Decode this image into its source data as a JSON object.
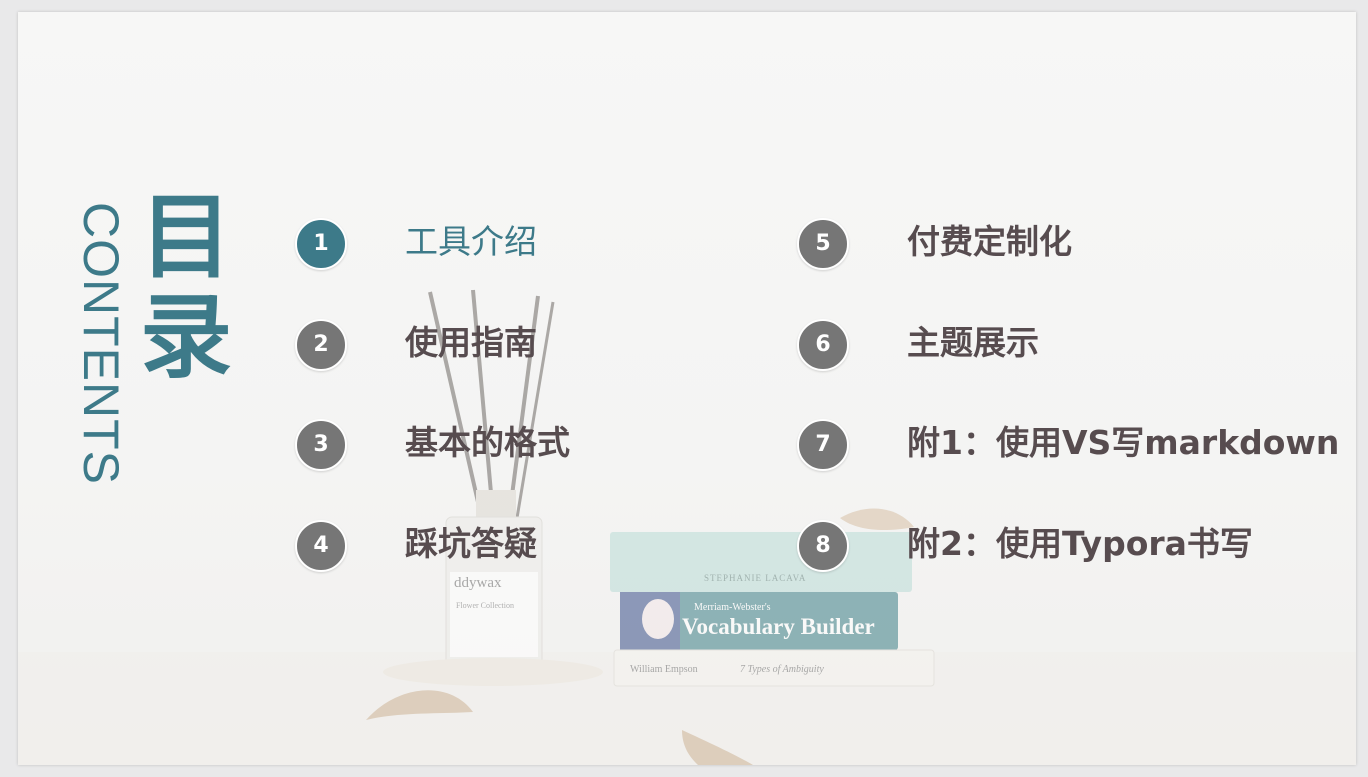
{
  "title": {
    "cn": "目录",
    "en": "CONTENTS"
  },
  "colors": {
    "accent": "#3d7a89",
    "badge": "#767676",
    "text": "#574c4f"
  },
  "items": [
    {
      "num": "1",
      "label": "工具介绍"
    },
    {
      "num": "2",
      "label": "使用指南"
    },
    {
      "num": "3",
      "label": "基本的格式"
    },
    {
      "num": "4",
      "label": "踩坑答疑"
    },
    {
      "num": "5",
      "label": "付费定制化"
    },
    {
      "num": "6",
      "label": "主题展示"
    },
    {
      "num": "7",
      "label": "附1：使用VS写markdown"
    },
    {
      "num": "8",
      "label": "附2：使用Typora书写"
    }
  ],
  "background_photo": {
    "jar_brand": "ddywax",
    "jar_sub": "Flower Collection",
    "book1_author": "STEPHANIE LACAVA",
    "book2_publisher": "Merriam-Webster's",
    "book2_title": "Vocabulary Builder",
    "book3_author": "William Empson",
    "book3_title": "7 Types of Ambiguity"
  }
}
